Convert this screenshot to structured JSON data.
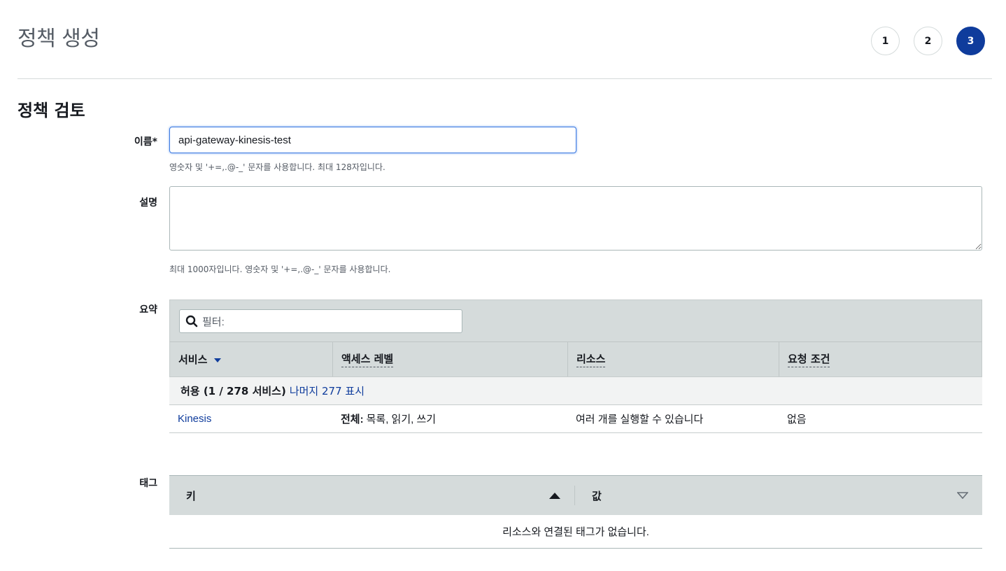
{
  "page": {
    "title": "정책 생성"
  },
  "steps": [
    "1",
    "2",
    "3"
  ],
  "section": {
    "title": "정책 검토"
  },
  "name_field": {
    "label": "이름*",
    "value": "api-gateway-kinesis-test",
    "hint": "영숫자 및 '+=,.@-_' 문자를 사용합니다. 최대 128자입니다."
  },
  "description_field": {
    "label": "설명",
    "value": "",
    "hint": "최대 1000자입니다. 영숫자 및 '+=,.@-_' 문자를 사용합니다."
  },
  "summary": {
    "label": "요약",
    "filter_placeholder": "필터:",
    "columns": [
      "서비스",
      "액세스 레벨",
      "리소스",
      "요청 조건"
    ],
    "group": {
      "text": "허용 (1 / 278 서비스)",
      "link": "나머지 277 표시"
    },
    "rows": [
      {
        "service": "Kinesis",
        "access_prefix": "전체:",
        "access": "목록, 읽기, 쓰기",
        "resource": "여러 개를 실행할 수 있습니다",
        "condition": "없음"
      }
    ]
  },
  "tags": {
    "label": "태그",
    "key_header": "키",
    "value_header": "값",
    "empty_text": "리소스와 연결된 태그가 없습니다."
  },
  "colors": {
    "accent": "#0f3c9c",
    "header_bg": "#d5dbdb",
    "focus": "#3c7ae1"
  }
}
